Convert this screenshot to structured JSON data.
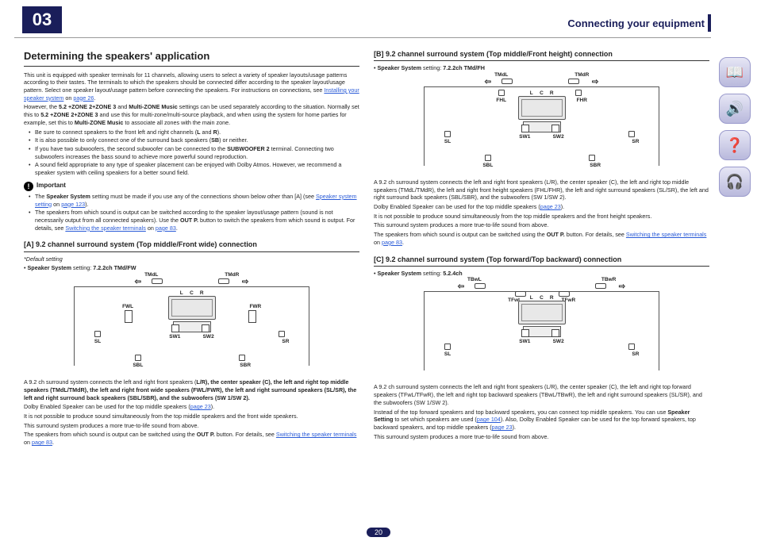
{
  "chapter": "03",
  "header_title": "Connecting your equipment",
  "page_number": "20",
  "sidebar": [
    {
      "name": "manual-icon",
      "glyph": "📖"
    },
    {
      "name": "equipment-icon",
      "glyph": "🔊"
    },
    {
      "name": "help-icon",
      "glyph": "❓"
    },
    {
      "name": "settings-icon",
      "glyph": "🎧"
    }
  ],
  "left": {
    "h1": "Determining the speakers' application",
    "intro1_a": "This unit is equipped with speaker terminals for 11 channels, allowing users to select a variety of speaker layouts/usage patterns according to their tastes. The terminals to which the speakers should be connected differ according to the speaker layout/usage pattern. Select one speaker layout/usage pattern before connecting the speakers. For instructions on connections, see ",
    "intro1_link": "Installing your speaker system",
    "intro1_b": " on ",
    "intro1_page": "page 26",
    "intro1_c": ".",
    "intro2_a": "However, the ",
    "intro2_b1": "5.2 +ZONE 2+ZONE 3",
    "intro2_b": " and ",
    "intro2_b2": "Multi-ZONE Music",
    "intro2_c": " settings can be used separately according to the situation. Normally set this to ",
    "intro2_b3": "5.2 +ZONE 2+ZONE 3",
    "intro2_d": " and use this for multi-zone/multi-source playback, and when using the system for home parties for example, set this to ",
    "intro2_b4": "Multi-ZONE Music",
    "intro2_e": " to associate all zones with the main zone.",
    "bullets1": [
      {
        "a": "Be sure to connect speakers to the front left and right channels (",
        "b": "L",
        "c": " and ",
        "d": "R",
        "e": ")."
      },
      {
        "a": "It is also possible to only connect one of the surround back speakers (",
        "b": "SB",
        "c": ") or neither."
      },
      {
        "a": "If you have two subwoofers, the second subwoofer can be connected to the ",
        "b": "SUBWOOFER 2",
        "c": " terminal. Connecting two subwoofers increases the bass sound to achieve more powerful sound reproduction."
      },
      {
        "a": "A sound field appropriate to any type of speaker placement can be enjoyed with Dolby Atmos. However, we recommend a speaker system with ceiling speakers for a better sound field."
      }
    ],
    "important_label": "Important",
    "imp_b1_a": "The ",
    "imp_b1_b": "Speaker System",
    "imp_b1_c": " setting must be made if you use any of the connections shown below other than [A] (see ",
    "imp_b1_link": "Speaker system setting",
    "imp_b1_d": " on ",
    "imp_b1_page": "page 123",
    "imp_b1_e": ").",
    "imp_b2_a": "The speakers from which sound is output can be switched according to the speaker layout/usage pattern (sound is not necessarily output from all connected speakers). Use the ",
    "imp_b2_b": "OUT P.",
    "imp_b2_c": " button to switch the speakers from which sound is output. For details, see ",
    "imp_b2_link": "Switching the speaker terminals",
    "imp_b2_d": " on ",
    "imp_b2_page": "page 83",
    "imp_b2_e": ".",
    "secA_title": "[A] 9.2 channel surround system (Top middle/Front wide) connection",
    "secA_default": "*Default setting",
    "secA_setting_lbl": "Speaker System",
    "secA_setting_val": " setting: ",
    "secA_setting_v": "7.2.2ch TMd/FW",
    "secA_p1_a": "A 9.2 ch surround system connects the left and right front speakers (",
    "secA_p1": "L/R), the center speaker (C), the left and right top middle speakers (TMdL/TMdR), the left and right front wide speakers (FWL/FWR), the left and right surround speakers (SL/SR), the left and right surround back speakers (SBL/SBR), and the subwoofers (SW 1/SW 2).",
    "secA_p2_a": "Dolby Enabled Speaker can be used for the top middle speakers (",
    "secA_p2_link": "page 23",
    "secA_p2_b": ").",
    "secA_p3": "It is not possible to produce sound simultaneously from the top middle speakers and the front wide speakers.",
    "secA_p4": "This surround system produces a more true-to-life sound from above.",
    "secA_p5_a": "The speakers from which sound is output can be switched using the ",
    "secA_p5_b": "OUT P.",
    "secA_p5_c": " button. For details, see ",
    "secA_p5_link": "Switching the speaker terminals",
    "secA_p5_d": " on ",
    "secA_p5_page": "page 83",
    "secA_p5_e": "."
  },
  "right": {
    "secB_title": "[B] 9.2 channel surround system (Top middle/Front height) connection",
    "secB_setting_lbl": "Speaker System",
    "secB_setting_val": " setting: ",
    "secB_setting_v": "7.2.2ch TMd/FH",
    "secB_p1": "A 9.2 ch surround system connects the left and right front speakers (L/R), the center speaker (C), the left and right top middle speakers (TMdL/TMdR), the left and right front height speakers (FHL/FHR), the left and right surround speakers (SL/SR), the left and right surround back speakers (SBL/SBR), and the subwoofers (SW 1/SW 2).",
    "secB_p2_a": "Dolby Enabled Speaker can be used for the top middle speakers (",
    "secB_p2_link": "page 23",
    "secB_p2_b": ").",
    "secB_p3": "It is not possible to produce sound simultaneously from the top middle speakers and the front height speakers.",
    "secB_p4": "This surround system produces a more true-to-life sound from above.",
    "secB_p5_a": "The speakers from which sound is output can be switched using the ",
    "secB_p5_b": "OUT P.",
    "secB_p5_c": " button. For details, see ",
    "secB_p5_link": "Switching the speaker terminals",
    "secB_p5_d": " on ",
    "secB_p5_page": "page 83",
    "secB_p5_e": ".",
    "secC_title": "[C] 9.2 channel surround system (Top forward/Top backward) connection",
    "secC_setting_lbl": "Speaker System",
    "secC_setting_val": " setting: ",
    "secC_setting_v": "5.2.4ch",
    "secC_p1": "A 9.2 ch surround system connects the left and right front speakers (L/R), the center speaker (C), the left and right top forward speakers (TFwL/TFwR), the left and right top backward speakers (TBwL/TBwR), the left and right surround speakers (SL/SR), and the subwoofers (SW 1/SW 2).",
    "secC_p2_a": "Instead of the top forward speakers and top backward speakers, you can connect top middle speakers. You can use ",
    "secC_p2_b": "Speaker Setting",
    "secC_p2_c": " to set which speakers are used (",
    "secC_p2_link": "page 104",
    "secC_p2_d": "). Also, Dolby Enabled Speaker can be used for the top forward speakers, top backward speakers, and top middle speakers (",
    "secC_p2_link2": "page 23",
    "secC_p2_e": ").",
    "secC_p3": "This surround system produces a more true-to-life sound from above."
  },
  "dia": {
    "TMdL": "TMdL",
    "TMdR": "TMdR",
    "FWL": "FWL",
    "FWR": "FWR",
    "FHL": "FHL",
    "FHR": "FHR",
    "L": "L",
    "C": "C",
    "R": "R",
    "SL": "SL",
    "SR": "SR",
    "SBL": "SBL",
    "SBR": "SBR",
    "SW1": "SW1",
    "SW2": "SW2",
    "TFwL": "TFwL",
    "TFwR": "TFwR",
    "TBwL": "TBwL",
    "TBwR": "TBwR"
  }
}
